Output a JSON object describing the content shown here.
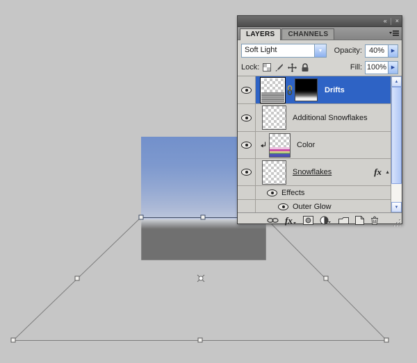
{
  "panel": {
    "titlebar": {
      "collapse_glyph": "«",
      "close_glyph": "×"
    },
    "tabs": [
      {
        "label": "LAYERS",
        "active": true
      },
      {
        "label": "CHANNELS",
        "active": false
      }
    ],
    "blend": {
      "value": "Soft Light"
    },
    "opacity": {
      "label": "Opacity:",
      "value": "40%"
    },
    "lock": {
      "label": "Lock:"
    },
    "fill": {
      "label": "Fill:",
      "value": "100%"
    },
    "layers": [
      {
        "name": "Drifts",
        "selected": true,
        "has_mask": true,
        "blend_thumb": "sky-water"
      },
      {
        "name": "Additional Snowflakes"
      },
      {
        "name": "Color",
        "clipped": true
      },
      {
        "name": "Snowflakes",
        "has_effects": true
      }
    ],
    "effects": {
      "header": "Effects",
      "items": [
        "Outer Glow"
      ]
    },
    "fx_badge": "fx",
    "icons": {
      "dropdown_arrow": "▼",
      "stepper_arrow": "▶",
      "scroll_up": "▲",
      "scroll_down": "▼",
      "fx_toggle": "▲"
    }
  },
  "canvas": {
    "tool": "free-transform-perspective",
    "colors": {
      "selection_blue": "#2E63C5",
      "sky_top": "#7290CB",
      "sky_horizon": "#BDC6DC",
      "background_gray": "#C6C6C6"
    }
  }
}
